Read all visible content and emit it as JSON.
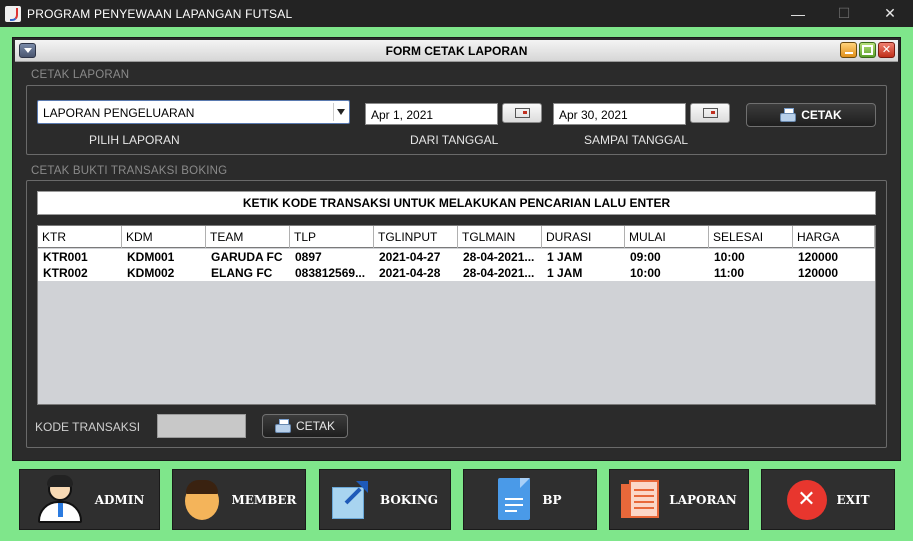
{
  "window": {
    "title": "PROGRAM PENYEWAAN LAPANGAN FUTSAL",
    "minimize": "—",
    "maximize": "☐",
    "close": "✕"
  },
  "form": {
    "title": "FORM CETAK LAPORAN"
  },
  "cetak_laporan": {
    "section_title": "CETAK LAPORAN",
    "report_type_value": "LAPORAN PENGELUARAN",
    "pilih_label": "PILIH LAPORAN",
    "from_date_value": "Apr 1, 2021",
    "from_label": "DARI TANGGAL",
    "to_date_value": "Apr 30, 2021",
    "to_label": "SAMPAI TANGGAL",
    "print_button": "CETAK"
  },
  "bukti": {
    "section_title": "CETAK BUKTI TRANSAKSI BOKING",
    "hint": "KETIK KODE TRANSAKSI UNTUK MELAKUKAN PENCARIAN LALU ENTER",
    "columns": [
      "KTR",
      "KDM",
      "TEAM",
      "TLP",
      "TGLINPUT",
      "TGLMAIN",
      "DURASI",
      "MULAI",
      "SELESAI",
      "HARGA"
    ],
    "rows": [
      [
        "KTR001",
        "KDM001",
        "GARUDA FC",
        "0897",
        "2021-04-27",
        "28-04-2021...",
        "1 JAM",
        "09:00",
        "10:00",
        "120000"
      ],
      [
        "KTR002",
        "KDM002",
        "ELANG FC",
        "083812569...",
        "2021-04-28",
        "28-04-2021...",
        "1 JAM",
        "10:00",
        "11:00",
        "120000"
      ]
    ],
    "kode_label": "KODE TRANSAKSI",
    "kode_value": "",
    "print_button": "CETAK"
  },
  "nav": {
    "admin": "ADMIN",
    "member": "MEMBER",
    "boking": "BOKING",
    "bp": "BP",
    "laporan": "LAPORAN",
    "exit": "EXIT"
  },
  "colors": {
    "frame_green": "#7fe68b",
    "background": "#2b2b2b",
    "exit_red": "#e8362e"
  }
}
